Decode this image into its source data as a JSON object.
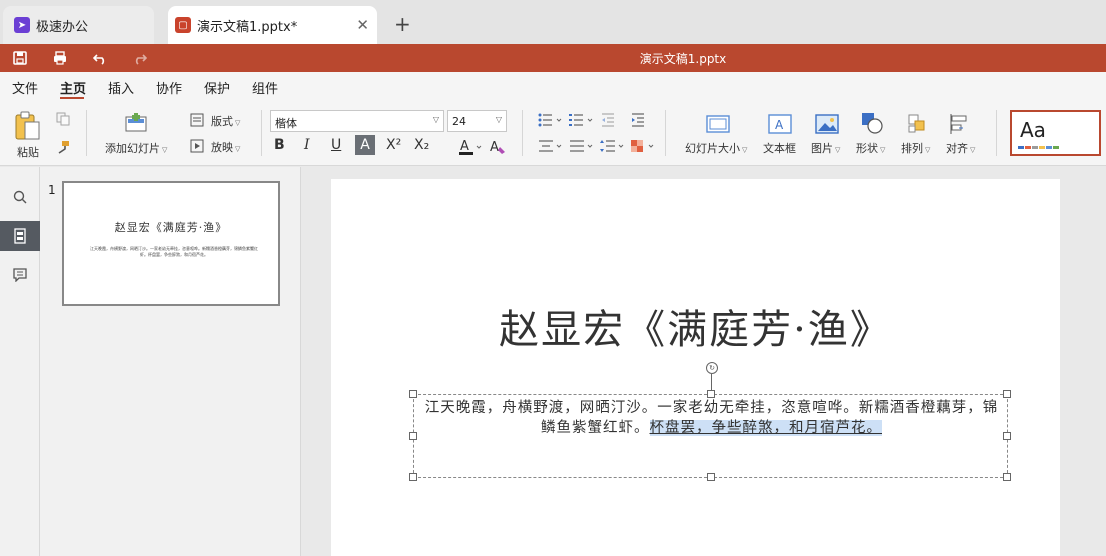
{
  "tabs": [
    {
      "label": "极速办公",
      "icon": "rocket-icon"
    },
    {
      "label": "演示文稿1.pptx*",
      "icon": "presentation-icon"
    }
  ],
  "titlebar": {
    "doc_title": "演示文稿1.pptx",
    "accent": "#b9482f"
  },
  "menu": {
    "items": [
      "文件",
      "主页",
      "插入",
      "协作",
      "保护",
      "组件"
    ],
    "active": "主页"
  },
  "ribbon": {
    "paste": "粘贴",
    "add_slide": "添加幻灯片",
    "layout": "版式",
    "play": "放映",
    "font_name": "楷体",
    "font_size": "24",
    "slide_size": "幻灯片大小",
    "textbox": "文本框",
    "picture": "图片",
    "shape": "形状",
    "arrange": "排列",
    "align": "对齐",
    "theme_sample": "Aa",
    "format_buttons": [
      "B",
      "I",
      "U",
      "A",
      "X²",
      "X₂"
    ]
  },
  "thumbnails": [
    {
      "number": "1",
      "title": "赵显宏《满庭芳·渔》",
      "body": "江天晚霞，舟横野渡，网晒汀沙。一家老幼无牵挂，恣意喧哗。新糯酒香橙藕芽，锦鳞鱼紫蟹红虾。杯盘罢，争些醉煞，和月宿芦花。"
    }
  ],
  "slide": {
    "title": "赵显宏《满庭芳·渔》",
    "body_before": "江天晚霞，舟横野渡，网晒汀沙。一家老幼无牵挂，恣意喧哗。新糯酒香橙藕芽，锦鳞鱼紫蟹红虾。",
    "body_selected": "杯盘罢，争些醉煞，和月宿芦花。"
  }
}
